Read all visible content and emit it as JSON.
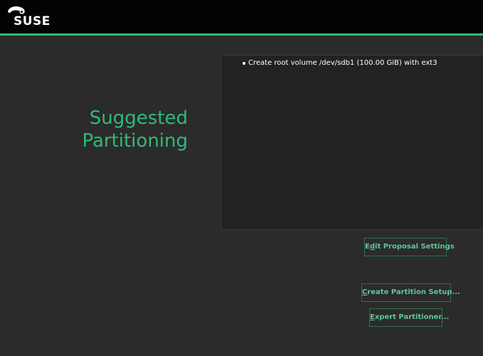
{
  "header": {
    "brand": "SUSE",
    "accent_color": "#30ba78",
    "background_color": "#020303"
  },
  "main": {
    "title_line1": "Suggested",
    "title_line2": "Partitioning",
    "proposal_items": [
      "Create root volume /dev/sdb1 (100.00 GiB) with ext3"
    ]
  },
  "buttons": {
    "edit_proposal": {
      "pre": "E",
      "mnemonic": "d",
      "post": "it Proposal Settings"
    },
    "create_partition_setup": {
      "pre": "",
      "mnemonic": "C",
      "post": "reate Partition Setup..."
    },
    "expert_partitioner": {
      "pre": "",
      "mnemonic": "E",
      "post": "xpert Partitioner..."
    }
  },
  "icons": {
    "logo": "suse-chameleon-logo"
  }
}
